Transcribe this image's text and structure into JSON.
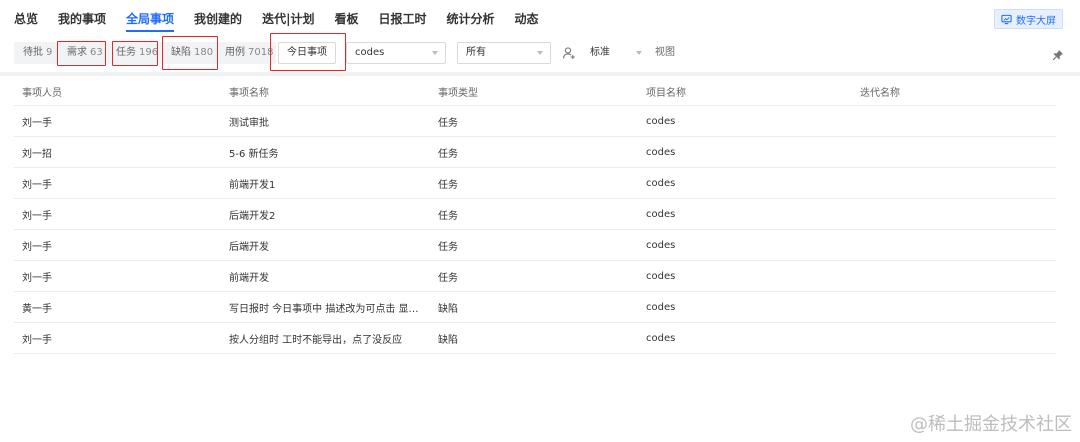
{
  "nav": {
    "items": [
      "总览",
      "我的事项",
      "全局事项",
      "我创建的",
      "迭代|计划",
      "看板",
      "日报工时",
      "统计分析",
      "动态"
    ],
    "active_index": 2,
    "bigscreen_label": "数字大屏"
  },
  "filters": {
    "counts": [
      {
        "label": "待批",
        "num": "9"
      },
      {
        "label": "需求",
        "num": "63"
      },
      {
        "label": "任务",
        "num": "196"
      },
      {
        "label": "缺陷",
        "num": "180"
      },
      {
        "label": "用例",
        "num": "7018"
      }
    ],
    "today_label": "今日事项",
    "project_select": "codes",
    "scope_select": "所有",
    "standard_select": "标准",
    "view_label": "视图"
  },
  "table": {
    "columns": [
      "事项人员",
      "事项名称",
      "事项类型",
      "项目名称",
      "迭代名称"
    ],
    "rows": [
      [
        "刘一手",
        "测试审批",
        "任务",
        "codes",
        ""
      ],
      [
        "刘一招",
        "5-6 新任务",
        "任务",
        "codes",
        ""
      ],
      [
        "刘一手",
        "前端开发1",
        "任务",
        "codes",
        ""
      ],
      [
        "刘一手",
        "后端开发2",
        "任务",
        "codes",
        ""
      ],
      [
        "刘一手",
        "后端开发",
        "任务",
        "codes",
        ""
      ],
      [
        "刘一手",
        "前端开发",
        "任务",
        "codes",
        ""
      ],
      [
        "黄一手",
        "写日报时 今日事项中 描述改为可点击 显示...",
        "缺陷",
        "codes",
        ""
      ],
      [
        "刘一手",
        "按人分组时 工时不能导出，点了没反应",
        "缺陷",
        "codes",
        ""
      ]
    ]
  },
  "watermark": "@稀土掘金技术社区",
  "colors": {
    "accent": "#1f6bff",
    "highlight_box": "#e5262b"
  }
}
